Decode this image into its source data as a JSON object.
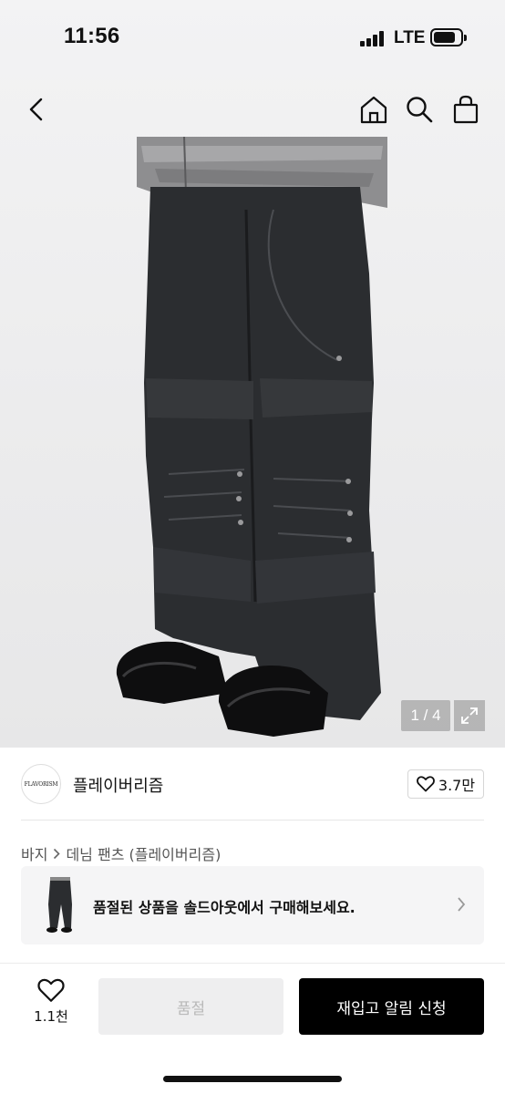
{
  "status_bar": {
    "time": "11:56",
    "network": "LTE"
  },
  "nav": {
    "back_icon": "chevron-left-icon",
    "home_icon": "home-icon",
    "search_icon": "search-icon",
    "bag_icon": "shopping-bag-icon"
  },
  "gallery": {
    "counter": "1 / 4",
    "expand_icon": "expand-icon"
  },
  "brand": {
    "logo_text": "FLAVORISM",
    "name": "플레이버리즘",
    "like_count": "3.7만"
  },
  "breadcrumb": {
    "category": "바지",
    "subcategory": "데님 팬츠 (플레이버리즘)"
  },
  "soldout_banner": {
    "text": "품절된 상품을 솔드아웃에서 구매해보세요."
  },
  "bottom_bar": {
    "wish_count": "1.1천",
    "soldout_label": "품절",
    "restock_label": "재입고 알림 신청"
  },
  "colors": {
    "accent": "#000000",
    "disabled_bg": "#eeeeef",
    "disabled_text": "#b9b9b9"
  }
}
